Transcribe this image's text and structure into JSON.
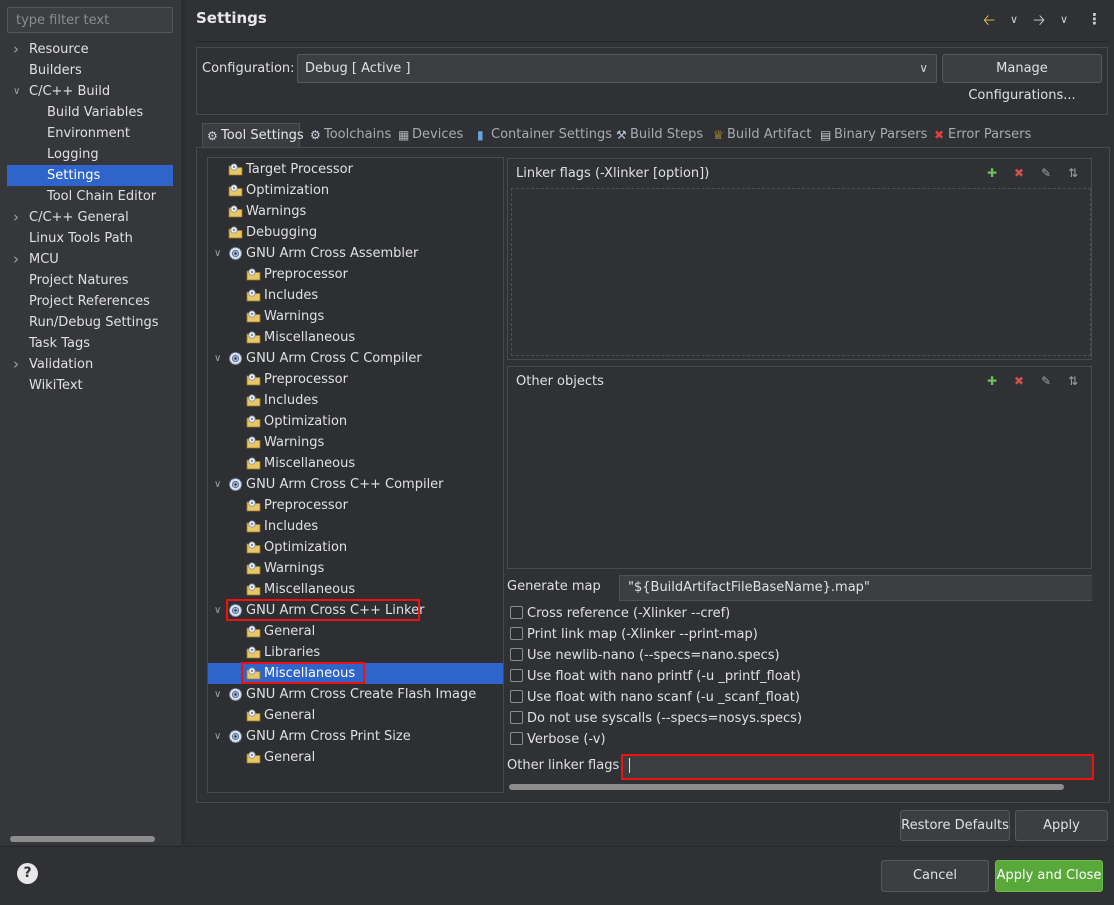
{
  "filter": {
    "placeholder": "type filter text"
  },
  "nav": {
    "items": [
      {
        "label": "Resource",
        "level": 0,
        "expandable": true,
        "expanded": false
      },
      {
        "label": "Builders",
        "level": 0,
        "expandable": false
      },
      {
        "label": "C/C++ Build",
        "level": 0,
        "expandable": true,
        "expanded": true
      },
      {
        "label": "Build Variables",
        "level": 1
      },
      {
        "label": "Environment",
        "level": 1
      },
      {
        "label": "Logging",
        "level": 1
      },
      {
        "label": "Settings",
        "level": 1,
        "selected": true
      },
      {
        "label": "Tool Chain Editor",
        "level": 1
      },
      {
        "label": "C/C++ General",
        "level": 0,
        "expandable": true,
        "expanded": false
      },
      {
        "label": "Linux Tools Path",
        "level": 0
      },
      {
        "label": "MCU",
        "level": 0,
        "expandable": true,
        "expanded": false
      },
      {
        "label": "Project Natures",
        "level": 0
      },
      {
        "label": "Project References",
        "level": 0
      },
      {
        "label": "Run/Debug Settings",
        "level": 0
      },
      {
        "label": "Task Tags",
        "level": 0
      },
      {
        "label": "Validation",
        "level": 0,
        "expandable": true,
        "expanded": false
      },
      {
        "label": "WikiText",
        "level": 0
      }
    ]
  },
  "header": {
    "title": "Settings",
    "icons": [
      "back-arrow-icon",
      "chevron-down-icon",
      "forward-arrow-icon",
      "chevron-down-icon",
      "kebab-menu-icon"
    ]
  },
  "config": {
    "label": "Configuration:",
    "value": "Debug  [ Active ]",
    "manage_label": "Manage Configurations..."
  },
  "tabs": [
    {
      "label": "Tool Settings",
      "icon": "gear-icon",
      "active": true
    },
    {
      "label": "Toolchains",
      "icon": "gear-icon"
    },
    {
      "label": "Devices",
      "icon": "chip-icon"
    },
    {
      "label": "Container Settings",
      "icon": "container-icon"
    },
    {
      "label": "Build Steps",
      "icon": "wrench-icon"
    },
    {
      "label": "Build Artifact",
      "icon": "trophy-icon"
    },
    {
      "label": "Binary Parsers",
      "icon": "binary-icon"
    },
    {
      "label": "Error Parsers",
      "icon": "error-icon"
    }
  ],
  "tool_tree": [
    {
      "label": "Target Processor",
      "level": 0,
      "icon": "option-folder-icon"
    },
    {
      "label": "Optimization",
      "level": 0,
      "icon": "option-folder-icon"
    },
    {
      "label": "Warnings",
      "level": 0,
      "icon": "option-folder-icon"
    },
    {
      "label": "Debugging",
      "level": 0,
      "icon": "option-folder-icon"
    },
    {
      "label": "GNU Arm Cross Assembler",
      "level": 0,
      "icon": "tool-gear-icon",
      "expanded": true
    },
    {
      "label": "Preprocessor",
      "level": 1,
      "icon": "option-folder-icon"
    },
    {
      "label": "Includes",
      "level": 1,
      "icon": "option-folder-icon"
    },
    {
      "label": "Warnings",
      "level": 1,
      "icon": "option-folder-icon"
    },
    {
      "label": "Miscellaneous",
      "level": 1,
      "icon": "option-folder-icon"
    },
    {
      "label": "GNU Arm Cross C Compiler",
      "level": 0,
      "icon": "tool-gear-icon",
      "expanded": true
    },
    {
      "label": "Preprocessor",
      "level": 1,
      "icon": "option-folder-icon"
    },
    {
      "label": "Includes",
      "level": 1,
      "icon": "option-folder-icon"
    },
    {
      "label": "Optimization",
      "level": 1,
      "icon": "option-folder-icon"
    },
    {
      "label": "Warnings",
      "level": 1,
      "icon": "option-folder-icon"
    },
    {
      "label": "Miscellaneous",
      "level": 1,
      "icon": "option-folder-icon"
    },
    {
      "label": "GNU Arm Cross C++ Compiler",
      "level": 0,
      "icon": "tool-gear-icon",
      "expanded": true
    },
    {
      "label": "Preprocessor",
      "level": 1,
      "icon": "option-folder-icon"
    },
    {
      "label": "Includes",
      "level": 1,
      "icon": "option-folder-icon"
    },
    {
      "label": "Optimization",
      "level": 1,
      "icon": "option-folder-icon"
    },
    {
      "label": "Warnings",
      "level": 1,
      "icon": "option-folder-icon"
    },
    {
      "label": "Miscellaneous",
      "level": 1,
      "icon": "option-folder-icon"
    },
    {
      "label": "GNU Arm Cross C++ Linker",
      "level": 0,
      "icon": "tool-gear-icon",
      "expanded": true,
      "highlighted": true
    },
    {
      "label": "General",
      "level": 1,
      "icon": "option-folder-icon"
    },
    {
      "label": "Libraries",
      "level": 1,
      "icon": "option-folder-icon"
    },
    {
      "label": "Miscellaneous",
      "level": 1,
      "icon": "option-folder-icon",
      "selected": true,
      "highlighted": true
    },
    {
      "label": "GNU Arm Cross Create Flash Image",
      "level": 0,
      "icon": "tool-gear-icon",
      "expanded": true
    },
    {
      "label": "General",
      "level": 1,
      "icon": "option-folder-icon"
    },
    {
      "label": "GNU Arm Cross Print Size",
      "level": 0,
      "icon": "tool-gear-icon",
      "expanded": true
    },
    {
      "label": "General",
      "level": 1,
      "icon": "option-folder-icon"
    }
  ],
  "linker_flags": {
    "title": "Linker flags (-Xlinker [option])"
  },
  "other_objects": {
    "title": "Other objects"
  },
  "list_tools": [
    "add-icon",
    "delete-icon",
    "edit-icon",
    "move-icon"
  ],
  "generate_map": {
    "label": "Generate map",
    "value": "\"${BuildArtifactFileBaseName}.map\""
  },
  "checkboxes": [
    {
      "label": "Cross reference (-Xlinker --cref)",
      "checked": false
    },
    {
      "label": "Print link map (-Xlinker --print-map)",
      "checked": false
    },
    {
      "label": "Use newlib-nano (--specs=nano.specs)",
      "checked": false
    },
    {
      "label": "Use float with nano printf (-u _printf_float)",
      "checked": false
    },
    {
      "label": "Use float with nano scanf (-u _scanf_float)",
      "checked": false
    },
    {
      "label": "Do not use syscalls (--specs=nosys.specs)",
      "checked": false
    },
    {
      "label": "Verbose (-v)",
      "checked": false
    }
  ],
  "other_linker_flags": {
    "label": "Other linker flags",
    "value": ""
  },
  "buttons": {
    "restore_defaults": "Restore Defaults",
    "apply": "Apply",
    "cancel": "Cancel",
    "apply_and_close": "Apply and Close",
    "help": "?"
  },
  "colors": {
    "selection": "#2f65ca",
    "highlight_box": "#e11111",
    "apply_close": "#59a83a"
  }
}
